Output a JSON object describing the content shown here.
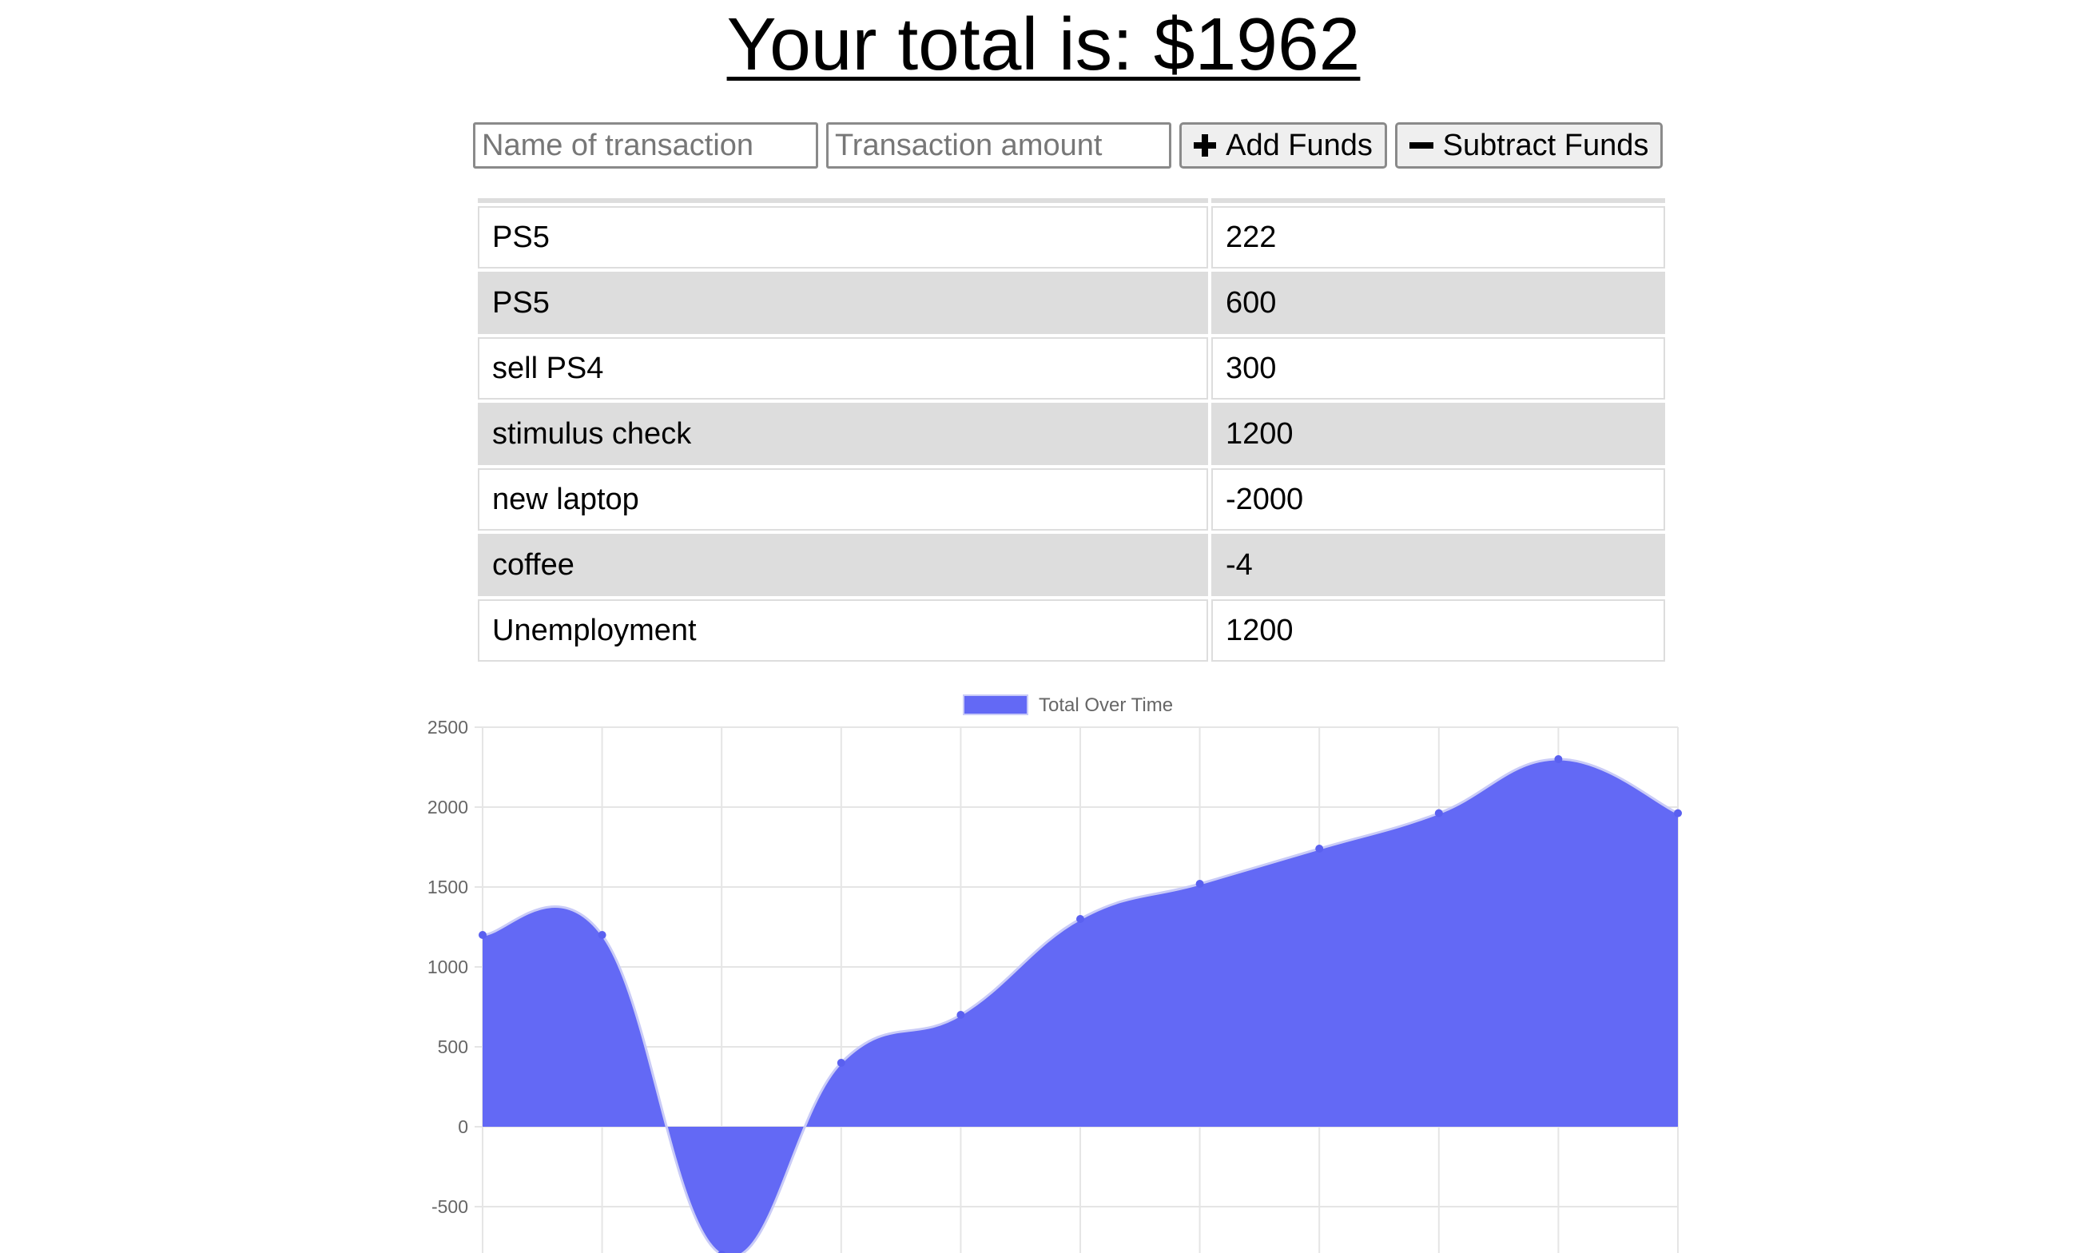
{
  "header": {
    "title": "Your total is: $1962"
  },
  "form": {
    "name_placeholder": "Name of transaction",
    "amount_placeholder": "Transaction amount",
    "add_label": "Add Funds",
    "subtract_label": "Subtract Funds"
  },
  "transactions": [
    {
      "name": "PS5",
      "amount": "222"
    },
    {
      "name": "PS5",
      "amount": "600"
    },
    {
      "name": "sell PS4",
      "amount": "300"
    },
    {
      "name": "stimulus check",
      "amount": "1200"
    },
    {
      "name": "new laptop",
      "amount": "-2000"
    },
    {
      "name": "coffee",
      "amount": "-4"
    },
    {
      "name": "Unemployment",
      "amount": "1200"
    }
  ],
  "colors": {
    "series_fill": "#6369f5",
    "series_point": "#5a60f0",
    "grid": "#e5e5e5",
    "axis_text": "#666666"
  },
  "chart_data": {
    "type": "area",
    "title": "",
    "legend": "top-center",
    "grid": true,
    "series": [
      {
        "name": "Total Over Time",
        "values": [
          1200,
          1200,
          -800,
          400,
          700,
          1300,
          1520,
          1740,
          1962,
          2300,
          1962
        ]
      }
    ],
    "x": [
      "",
      "",
      "",
      "",
      "",
      "",
      "",
      "",
      "",
      "",
      ""
    ],
    "ylim": [
      -800,
      2500
    ],
    "yticks": [
      "2500",
      "2000",
      "1500",
      "1000",
      "500",
      "0",
      "-500"
    ]
  }
}
